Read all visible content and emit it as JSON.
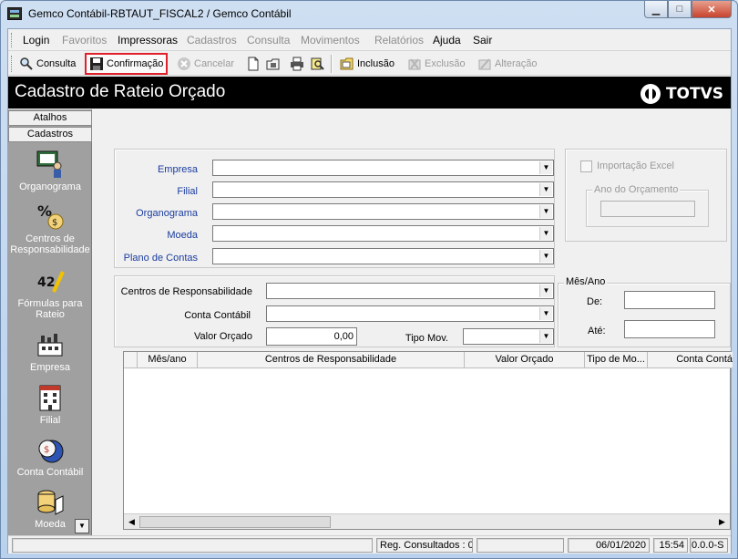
{
  "window": {
    "title": "Gemco Contábil-RBTAUT_FISCAL2 / Gemco Contábil"
  },
  "menu": [
    {
      "label": "Login",
      "enabled": true
    },
    {
      "label": "Favoritos",
      "enabled": false
    },
    {
      "label": "Impressoras",
      "enabled": true
    },
    {
      "label": "Cadastros",
      "enabled": false
    },
    {
      "label": "Consulta",
      "enabled": false
    },
    {
      "label": "Movimentos",
      "enabled": false
    },
    {
      "label": "Relatórios",
      "enabled": false
    },
    {
      "label": "Ajuda",
      "enabled": true
    },
    {
      "label": "Sair",
      "enabled": true
    }
  ],
  "toolbar": {
    "consulta": "Consulta",
    "confirmacao": "Confirmação",
    "cancelar": "Cancelar",
    "inclusao": "Inclusão",
    "exclusao": "Exclusão",
    "alteracao": "Alteração"
  },
  "banner": {
    "title": "Cadastro de Rateio Orçado",
    "brand": "TOTVS"
  },
  "sidebar": {
    "tabs": {
      "atalhos": "Atalhos",
      "cadastros": "Cadastros"
    },
    "items": [
      {
        "label": "Organograma"
      },
      {
        "label": "Centros de Responsabilidade"
      },
      {
        "label": "Fórmulas para Rateio"
      },
      {
        "label": "Empresa"
      },
      {
        "label": "Filial"
      },
      {
        "label": "Conta Contábil"
      },
      {
        "label": "Moeda"
      }
    ]
  },
  "form": {
    "empresa": "Empresa",
    "filial": "Filial",
    "organograma": "Organograma",
    "moeda": "Moeda",
    "plano_contas": "Plano de Contas",
    "importacao_excel": "Importação Excel",
    "ano_orcamento": "Ano do Orçamento",
    "centros_resp": "Centros de Responsabilidade",
    "conta_contabil": "Conta Contábil",
    "valor_orcado": "Valor Orçado",
    "valor_orcado_value": "0,00",
    "tipo_mov": "Tipo Mov.",
    "mes_ano": "Mês/Ano",
    "de": "De:",
    "ate": "Até:"
  },
  "grid": {
    "columns": [
      "Mês/ano",
      "Centros de Responsabilidade",
      "Valor Orçado",
      "Tipo de Mo...",
      "Conta Contá"
    ]
  },
  "status": {
    "registros": "Reg. Consultados : 0",
    "date": "06/01/2020",
    "time": "15:54",
    "version": "0.0.0-S"
  }
}
